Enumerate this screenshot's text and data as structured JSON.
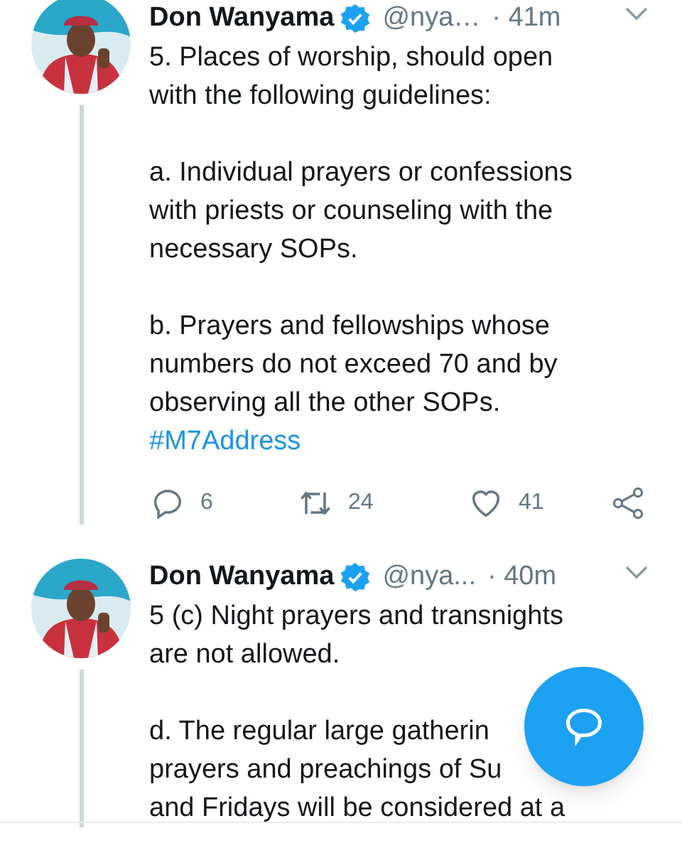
{
  "tweets": [
    {
      "name": "Don Wanyama",
      "verified": true,
      "handle": "@nya…",
      "time": "· 41m",
      "thread_line": true,
      "paragraphs": [
        [
          "5. Places of worship, should open",
          "with the following guidelines:"
        ],
        [
          "a. Individual prayers or confessions",
          "with priests or counseling with the",
          "necessary SOPs."
        ],
        [
          "b. Prayers and fellowships whose",
          "numbers do not exceed 70 and by",
          "observing all the other SOPs."
        ]
      ],
      "hashtag": "#M7Address",
      "actions": {
        "replies": "6",
        "retweets": "24",
        "likes": "41"
      }
    },
    {
      "name": "Don Wanyama",
      "verified": true,
      "handle": "@nya...",
      "time": "· 40m",
      "thread_line": true,
      "paragraphs": [
        [
          "5 (c) Night prayers and transnights",
          "are not allowed."
        ],
        [
          "d. The regular large gatherin",
          "prayers and preachings of Su",
          "and Fridays will be considered at a"
        ]
      ]
    }
  ]
}
